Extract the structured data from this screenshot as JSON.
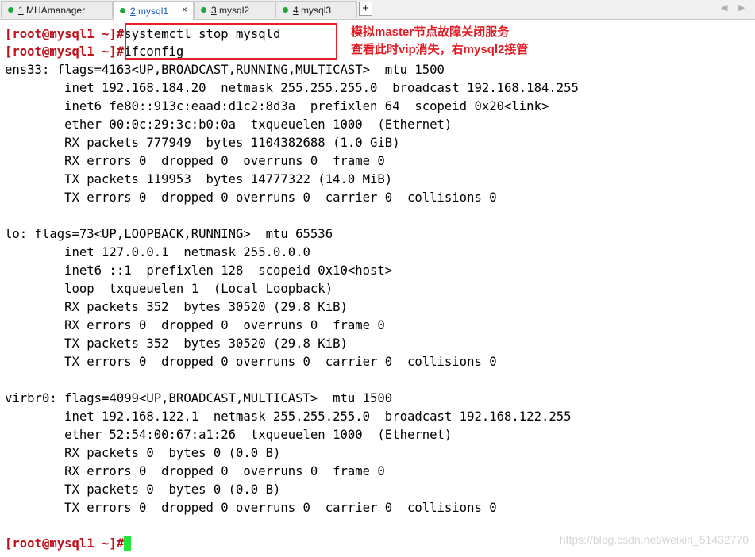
{
  "tabs": [
    {
      "num": "1",
      "name": "MHAmanager",
      "active": false
    },
    {
      "num": "2",
      "name": "mysql1",
      "active": true
    },
    {
      "num": "3",
      "name": "mysql2",
      "active": false
    },
    {
      "num": "4",
      "name": "mysql3",
      "active": false
    }
  ],
  "tab_close": "×",
  "add_tab": "+",
  "nav_prev": "◀",
  "nav_next": "▶",
  "prompt": "[root@mysql1 ~]#",
  "commands": {
    "cmd1": "systemctl stop mysqld",
    "cmd2": "ifconfig"
  },
  "annotations": [
    "模拟master节点故障关闭服务",
    "查看此时vip消失，右mysql2接管"
  ],
  "output": [
    "ens33: flags=4163<UP,BROADCAST,RUNNING,MULTICAST>  mtu 1500",
    "        inet 192.168.184.20  netmask 255.255.255.0  broadcast 192.168.184.255",
    "        inet6 fe80::913c:eaad:d1c2:8d3a  prefixlen 64  scopeid 0x20<link>",
    "        ether 00:0c:29:3c:b0:0a  txqueuelen 1000  (Ethernet)",
    "        RX packets 777949  bytes 1104382688 (1.0 GiB)",
    "        RX errors 0  dropped 0  overruns 0  frame 0",
    "        TX packets 119953  bytes 14777322 (14.0 MiB)",
    "        TX errors 0  dropped 0 overruns 0  carrier 0  collisions 0",
    "",
    "lo: flags=73<UP,LOOPBACK,RUNNING>  mtu 65536",
    "        inet 127.0.0.1  netmask 255.0.0.0",
    "        inet6 ::1  prefixlen 128  scopeid 0x10<host>",
    "        loop  txqueuelen 1  (Local Loopback)",
    "        RX packets 352  bytes 30520 (29.8 KiB)",
    "        RX errors 0  dropped 0  overruns 0  frame 0",
    "        TX packets 352  bytes 30520 (29.8 KiB)",
    "        TX errors 0  dropped 0 overruns 0  carrier 0  collisions 0",
    "",
    "virbr0: flags=4099<UP,BROADCAST,MULTICAST>  mtu 1500",
    "        inet 192.168.122.1  netmask 255.255.255.0  broadcast 192.168.122.255",
    "        ether 52:54:00:67:a1:26  txqueuelen 1000  (Ethernet)",
    "        RX packets 0  bytes 0 (0.0 B)",
    "        RX errors 0  dropped 0  overruns 0  frame 0",
    "        TX packets 0  bytes 0 (0.0 B)",
    "        TX errors 0  dropped 0 overruns 0  carrier 0  collisions 0"
  ],
  "watermark": "https://blog.csdn.net/weixin_51432770",
  "colors": {
    "prompt": "#c0101a",
    "annotation": "#e01c24",
    "cursor": "#22e63a",
    "tab_status_dot": "#26a33a"
  }
}
